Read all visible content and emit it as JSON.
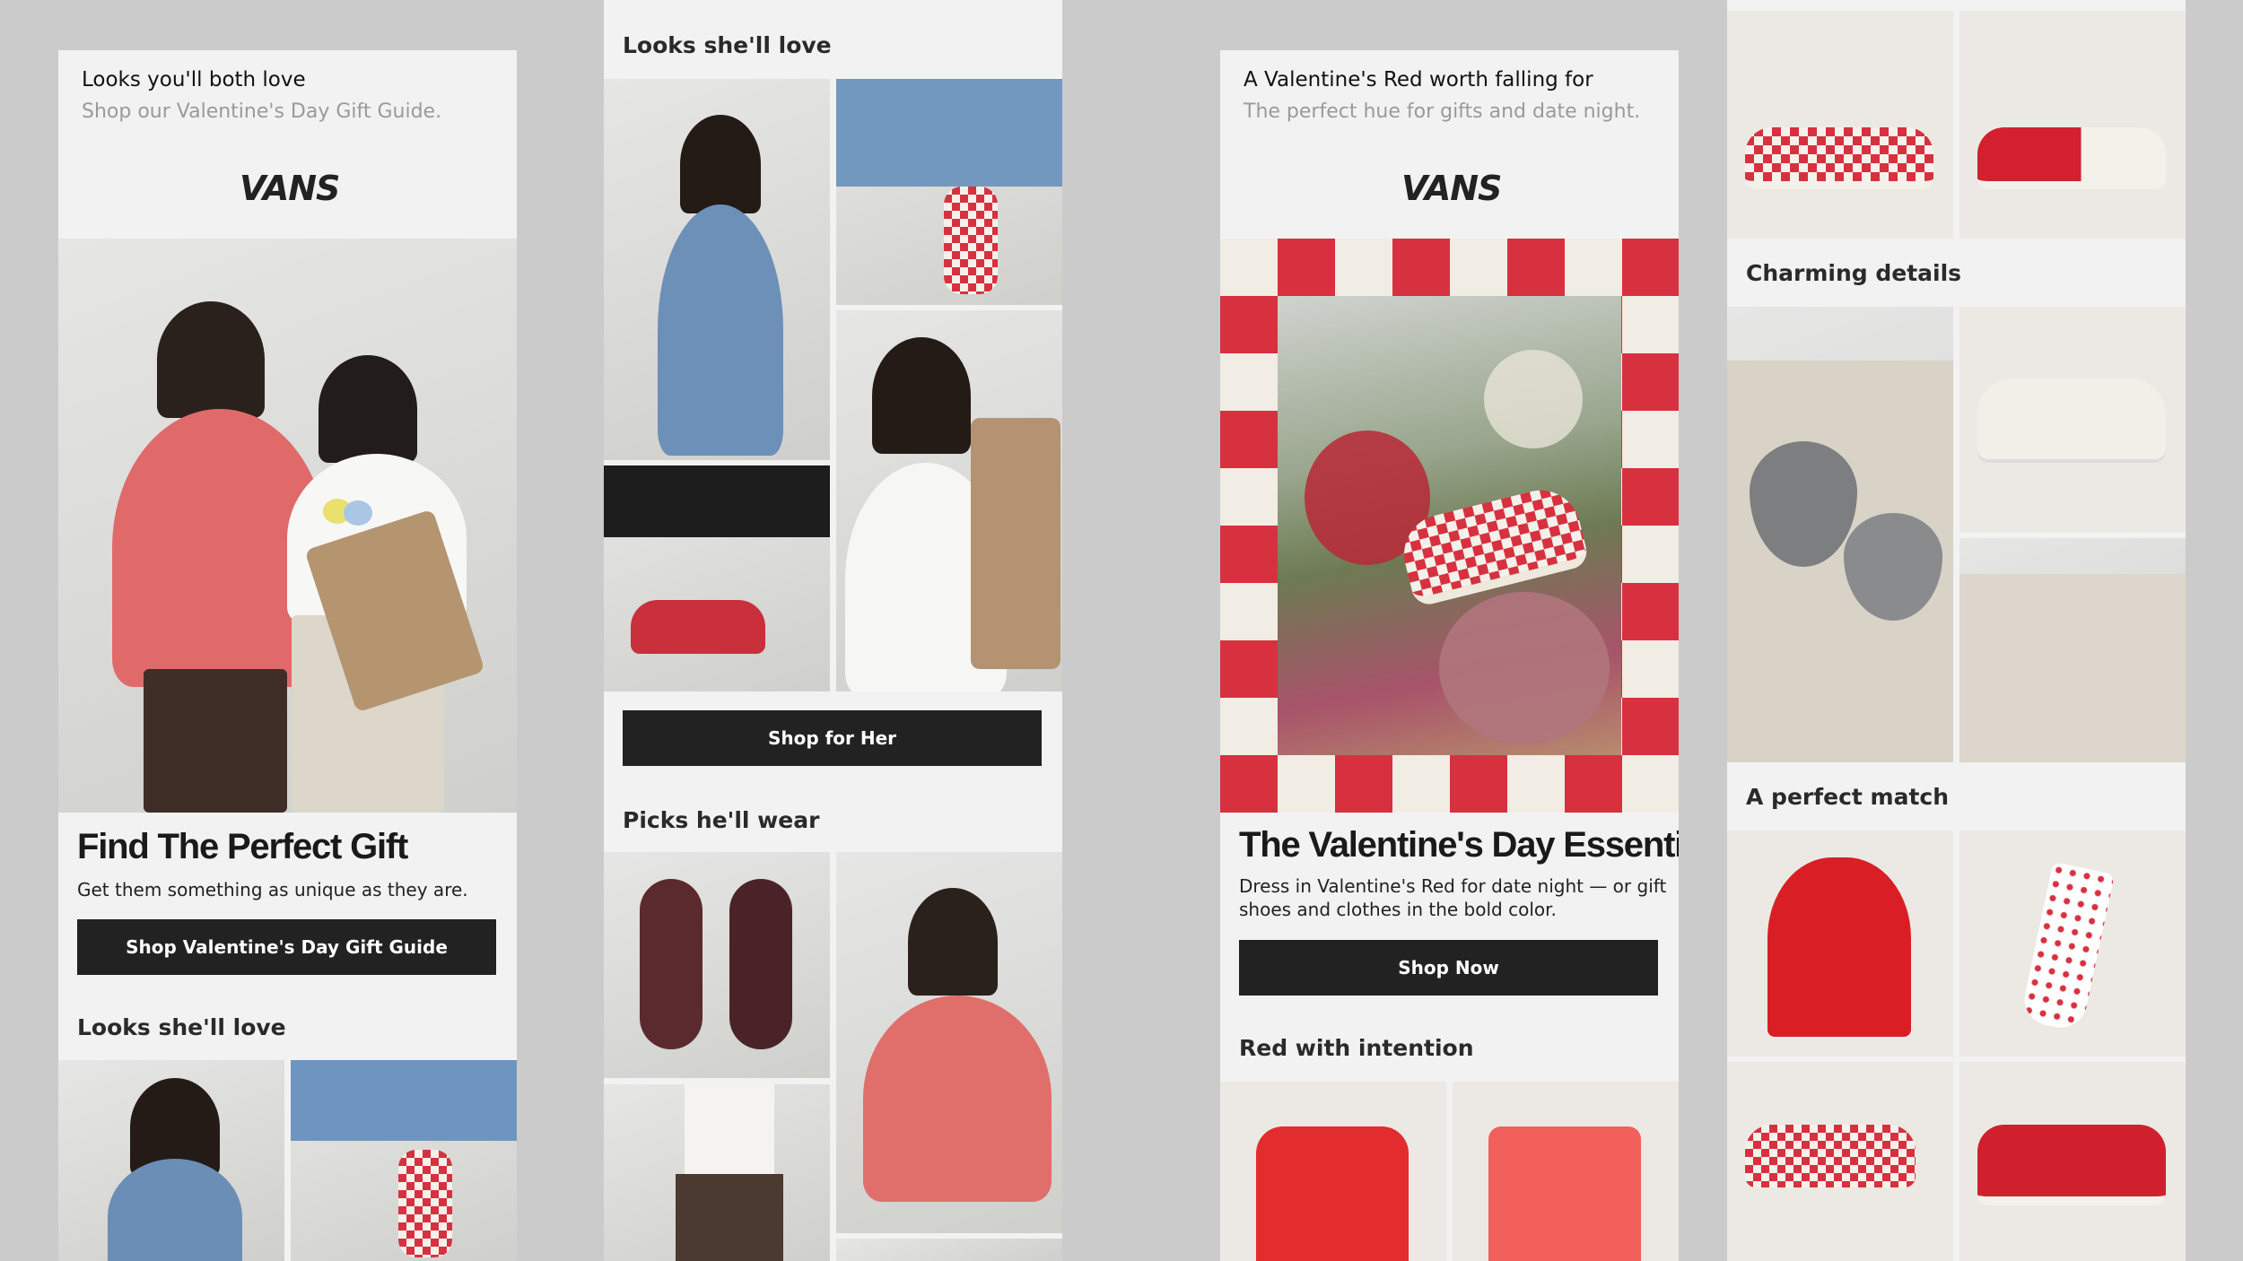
{
  "brand": {
    "logo": "VANS",
    "accent_red": "#d7313f",
    "dark": "#222222"
  },
  "panel1": {
    "header_title": "Looks you'll both love",
    "header_sub": "Shop our Valentine's Day Gift Guide.",
    "headline": "Find The Perfect Gift",
    "body": "Get them something as unique as they are.",
    "cta": "Shop Valentine's Day Gift Guide",
    "section": "Looks she'll love"
  },
  "panel2": {
    "section1": "Looks she'll love",
    "cta": "Shop for Her",
    "section2": "Picks he'll wear"
  },
  "panel3": {
    "header_title": "A Valentine's Red worth falling for",
    "header_sub": "The perfect hue for gifts and date night.",
    "headline": "The Valentine's Day Essential",
    "body_line1": "Dress in Valentine's Red for date night — or gift",
    "body_line2": "shoes and clothes in the bold color.",
    "cta": "Shop Now",
    "section": "Red with intention"
  },
  "panel4": {
    "section1": "Charming details",
    "section2": "A perfect match"
  }
}
